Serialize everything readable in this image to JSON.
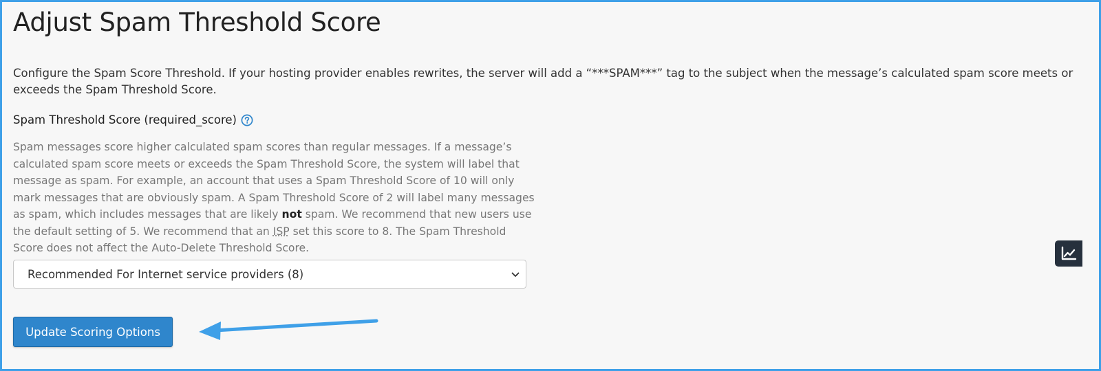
{
  "page": {
    "title": "Adjust Spam Threshold Score",
    "intro": "Configure the Spam Score Threshold. If your hosting provider enables rewrites, the server will add a “***SPAM***” tag to the subject when the message’s calculated spam score meets or exceeds the Spam Threshold Score."
  },
  "field": {
    "label": "Spam Threshold Score (required_score)",
    "help_icon": "question-circle-icon",
    "help_text_part1": "Spam messages score higher calculated spam scores than regular messages. If a message’s calculated spam score meets or exceeds the Spam Threshold Score, the system will label that message as spam. For example, an account that uses a Spam Threshold Score of 10 will only mark messages that are obviously spam. A Spam Threshold Score of 2 will label many messages as spam, which includes messages that are likely ",
    "help_text_bold": "not",
    "help_text_part2": " spam. We recommend that new users use the default setting of 5. We recommend that an ",
    "help_text_abbr": "ISP",
    "help_text_part3": " set this score to 8. The Spam Threshold Score does not affect the Auto-Delete Threshold Score.",
    "select_value": "Recommended For Internet service providers (8)"
  },
  "actions": {
    "update_label": "Update Scoring Options"
  },
  "side_widget": {
    "icon": "chart-line-icon"
  },
  "colors": {
    "primary_button": "#2f86cc",
    "help_icon": "#2f86cc",
    "annotation_arrow": "#3fa0e8",
    "frame_border": "#3fa0e8",
    "side_widget": "#26303d"
  }
}
